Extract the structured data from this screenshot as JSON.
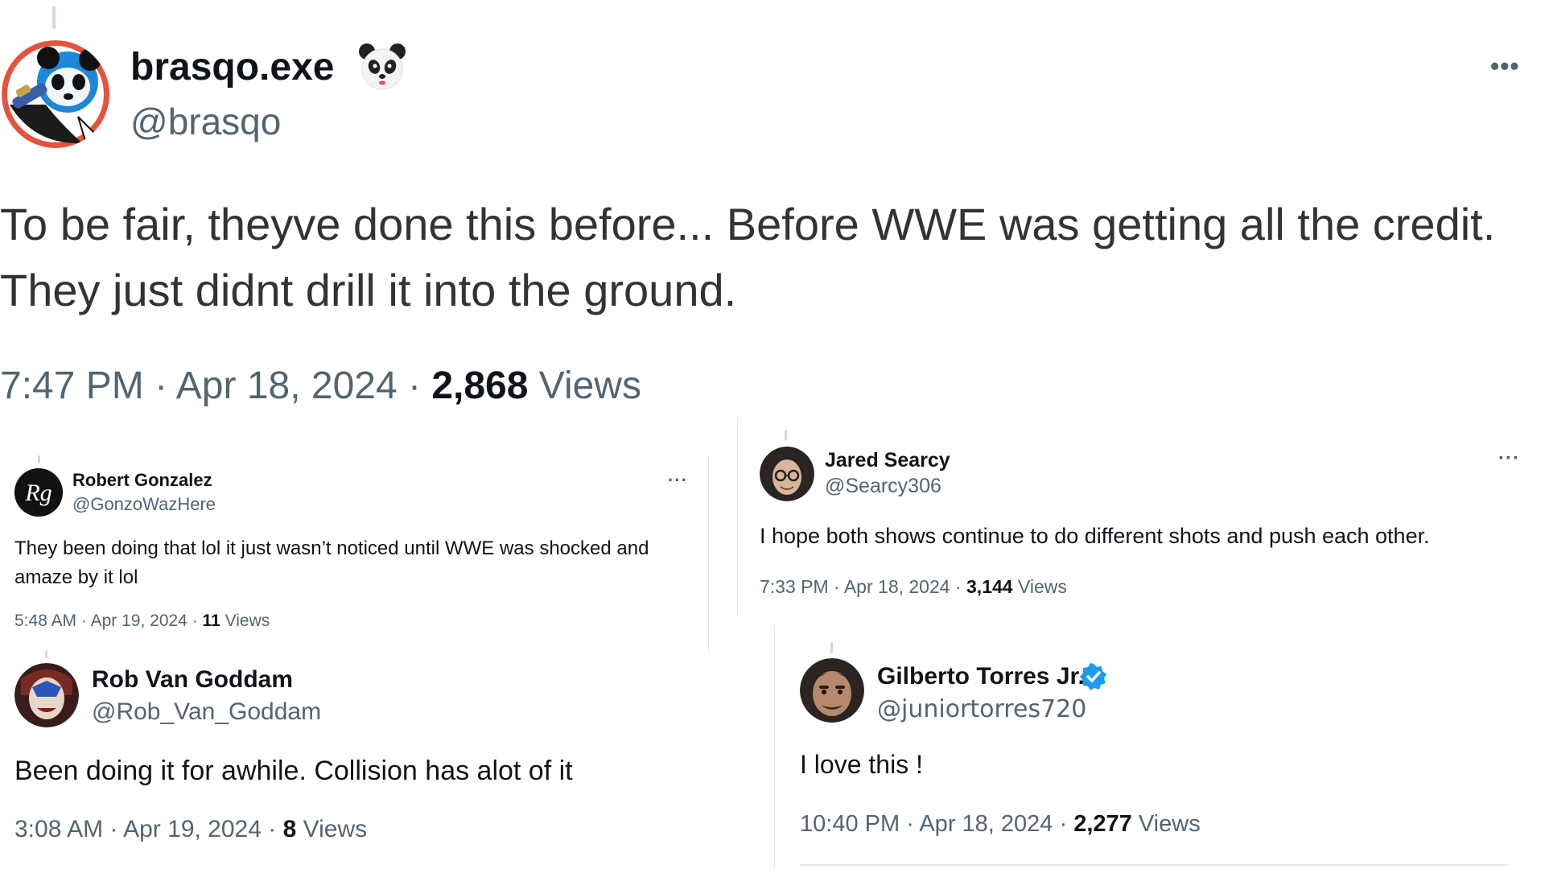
{
  "main_tweet": {
    "display_name": "brasqo.exe",
    "handle": "@brasqo",
    "text": "To be fair, theyve done this before... Before WWE was getting all the credit. They just didnt drill it into the ground.",
    "time": "7:47 PM",
    "date": "Apr 18, 2024",
    "views_count": "2,868",
    "views_label": "Views",
    "more": "•••"
  },
  "replies": [
    {
      "display_name": "Robert Gonzalez",
      "handle": "@GonzoWazHere",
      "text": "They been doing that lol it just wasn’t noticed until WWE was shocked and amaze by it lol",
      "time": "5:48 AM",
      "date": "Apr 19, 2024",
      "views_count": "11",
      "views_label": "Views",
      "more": "···"
    },
    {
      "display_name": "Jared Searcy",
      "handle": "@Searcy306",
      "text": "I hope both shows continue to do different shots and push each other.",
      "time": "7:33 PM",
      "date": "Apr 18, 2024",
      "views_count": "3,144",
      "views_label": "Views",
      "more": "···"
    },
    {
      "display_name": "Rob Van Goddam",
      "handle": "@Rob_Van_Goddam",
      "text": "Been doing it for awhile. Collision has alot of it",
      "time": "3:08 AM",
      "date": "Apr 19, 2024",
      "views_count": "8",
      "views_label": "Views"
    },
    {
      "display_name": "Gilberto Torres Jr.",
      "handle": "@juniortorres720",
      "text": "I love this !",
      "time": "10:40 PM",
      "date": "Apr 18, 2024",
      "views_count": "2,277",
      "views_label": "Views",
      "verified": true
    }
  ],
  "colors": {
    "text": "#0f1419",
    "secondary": "#536471",
    "verified": "#1d9bf0"
  }
}
